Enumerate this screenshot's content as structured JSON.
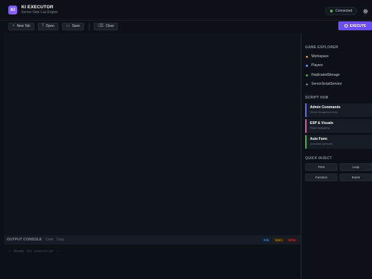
{
  "header": {
    "logo": "KI",
    "title": "KI EXECUTOR",
    "subtitle": "Server-Side Lua Engine",
    "status": "Connected",
    "status_color": "#3fb950"
  },
  "toolbar": {
    "new_tab": "New Tab",
    "open": "Open",
    "save": "Save",
    "clear": "Clear",
    "execute": "EXECUTE"
  },
  "console": {
    "title": "OUTPUT CONSOLE",
    "clear": "Clear",
    "copy": "Copy",
    "filters": {
      "info": "Info",
      "warn": "Warn",
      "error": "Error"
    },
    "output": "-- Ready for execution --"
  },
  "sidebar": {
    "explorer": {
      "title": "GAME EXPLORER",
      "items": [
        {
          "label": "Workspace",
          "color": "#d29922"
        },
        {
          "label": "Players",
          "color": "#58a6ff"
        },
        {
          "label": "ReplicatedStorage",
          "color": "#3fb950"
        },
        {
          "label": "ServerScriptService",
          "color": "#6e7681"
        }
      ]
    },
    "hub": {
      "title": "SCRIPT HUB",
      "cards": [
        {
          "name": "Admin Commands",
          "desc": "Server management tools",
          "color": "#6c6ff6"
        },
        {
          "name": "ESP & Visuals",
          "desc": "Player highlighting",
          "color": "#db61a2"
        },
        {
          "name": "Auto Farm",
          "desc": "Automated gameplay",
          "color": "#3fb950"
        }
      ]
    },
    "quick": {
      "title": "QUICK INJECT",
      "buttons": [
        "Print",
        "Loop",
        "Function",
        "Event"
      ]
    }
  },
  "colors": {
    "accent": "#6c4ef2",
    "background": "#0d1117"
  }
}
